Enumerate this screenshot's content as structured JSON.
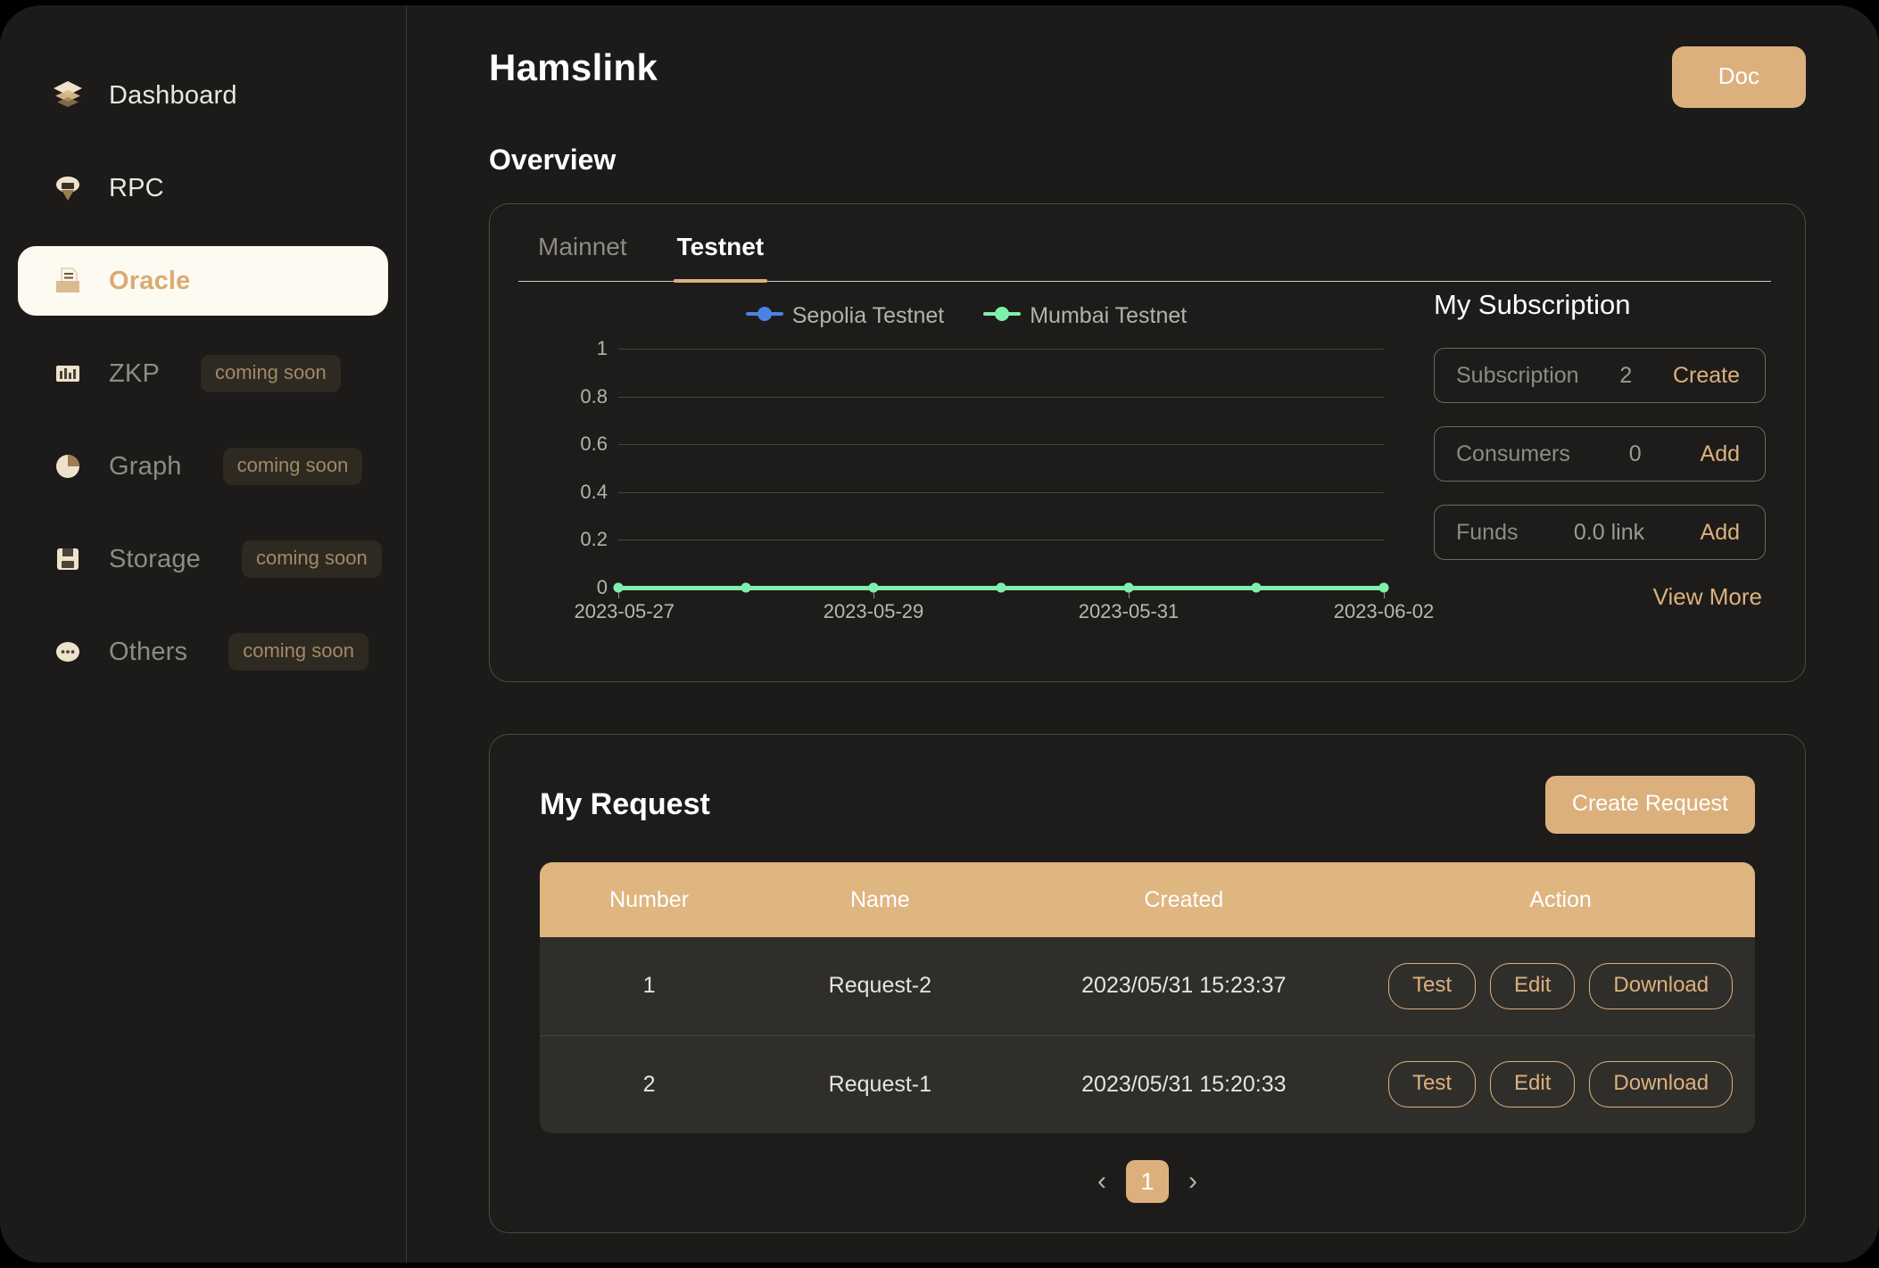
{
  "sidebar": {
    "items": [
      {
        "label": "Dashboard",
        "icon": "layers-icon",
        "state": "enabled",
        "badge": null
      },
      {
        "label": "RPC",
        "icon": "cloud-download-icon",
        "state": "enabled",
        "badge": null
      },
      {
        "label": "Oracle",
        "icon": "document-tray-icon",
        "state": "active",
        "badge": null
      },
      {
        "label": "ZKP",
        "icon": "barcode-icon",
        "state": "disabled",
        "badge": "coming soon"
      },
      {
        "label": "Graph",
        "icon": "pie-chart-icon",
        "state": "disabled",
        "badge": "coming soon"
      },
      {
        "label": "Storage",
        "icon": "floppy-disk-icon",
        "state": "disabled",
        "badge": "coming soon"
      },
      {
        "label": "Others",
        "icon": "ellipsis-bubble-icon",
        "state": "disabled",
        "badge": "coming soon"
      }
    ]
  },
  "header": {
    "title": "Hamslink",
    "doc_label": "Doc"
  },
  "overview": {
    "title": "Overview",
    "tabs": [
      {
        "label": "Mainnet",
        "active": false
      },
      {
        "label": "Testnet",
        "active": true
      }
    ]
  },
  "chart_data": {
    "type": "line",
    "title": "",
    "xlabel": "",
    "ylabel": "",
    "ylim": [
      0,
      1
    ],
    "yticks": [
      "0",
      "0.2",
      "0.4",
      "0.6",
      "0.8",
      "1"
    ],
    "ytick_values": [
      0,
      0.2,
      0.4,
      0.6,
      0.8,
      1
    ],
    "x": [
      "2023-05-27",
      "2023-05-28",
      "2023-05-29",
      "2023-05-30",
      "2023-05-31",
      "2023-06-01",
      "2023-06-02"
    ],
    "xtick_labels": [
      "2023-05-27",
      "2023-05-29",
      "2023-05-31",
      "2023-06-02"
    ],
    "xtick_indices": [
      0,
      2,
      4,
      6
    ],
    "grid": true,
    "legend_position": "top-center",
    "series": [
      {
        "name": "Sepolia Testnet",
        "color": "#4b82e6",
        "values": [
          0,
          0,
          0,
          0,
          0,
          0,
          0
        ]
      },
      {
        "name": "Mumbai Testnet",
        "color": "#7fefab",
        "values": [
          0,
          0,
          0,
          0,
          0,
          0,
          0
        ]
      }
    ]
  },
  "subscription": {
    "title": "My Subscription",
    "rows": [
      {
        "label": "Subscription",
        "value": "2",
        "action": "Create"
      },
      {
        "label": "Consumers",
        "value": "0",
        "action": "Add"
      },
      {
        "label": "Funds",
        "value": "0.0 link",
        "action": "Add"
      }
    ],
    "view_more": "View More"
  },
  "request": {
    "title": "My Request",
    "create_label": "Create Request",
    "columns": [
      "Number",
      "Name",
      "Created",
      "Action"
    ],
    "rows": [
      {
        "number": "1",
        "name": "Request-2",
        "created": "2023/05/31 15:23:37",
        "actions": [
          "Test",
          "Edit",
          "Download"
        ]
      },
      {
        "number": "2",
        "name": "Request-1",
        "created": "2023/05/31 15:20:33",
        "actions": [
          "Test",
          "Edit",
          "Download"
        ]
      }
    ],
    "pagination": {
      "prev": "‹",
      "page": "1",
      "next": "›"
    }
  },
  "colors": {
    "accent": "#dcb07d",
    "sepolia": "#4b82e6",
    "mumbai": "#7fefab",
    "page_bg": "#1c1b19"
  }
}
